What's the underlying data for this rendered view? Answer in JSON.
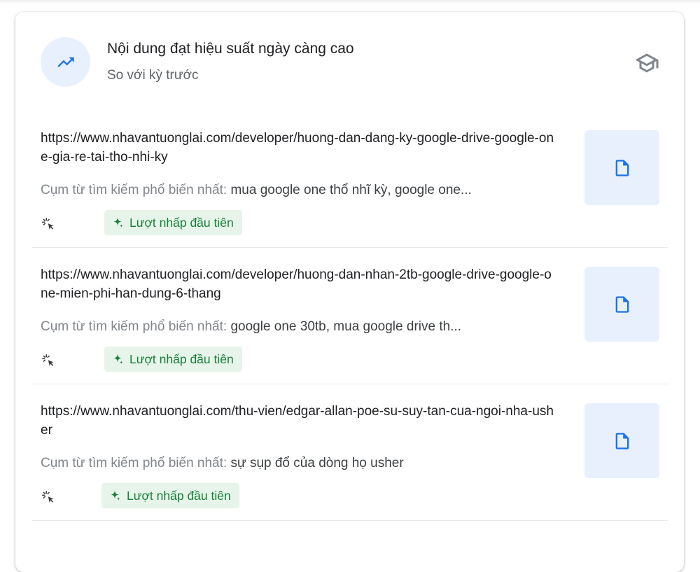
{
  "header": {
    "title": "Nội dung đạt hiệu suất ngày càng cao",
    "subtitle": "So với kỳ trước",
    "trend_icon": "trending-up-icon",
    "learn_icon": "graduation-cap-icon"
  },
  "colors": {
    "accent_blue": "#1a73e8",
    "chip_bg": "#e6f4ea",
    "chip_text": "#188038"
  },
  "rows": [
    {
      "url": "https://www.nhavantuonglai.com/developer/huong-dan-dang-ky-google-drive-google-one-gia-re-tai-tho-nhi-ky",
      "query_label": "Cụm từ tìm kiếm phổ biến nhất: ",
      "query_value": "mua google one thổ nhĩ kỳ, google one...",
      "badge": "Lượt nhấp đầu tiên"
    },
    {
      "url": "https://www.nhavantuonglai.com/developer/huong-dan-nhan-2tb-google-drive-google-one-mien-phi-han-dung-6-thang",
      "query_label": "Cụm từ tìm kiếm phổ biến nhất: ",
      "query_value": "google one 30tb, mua google drive th...",
      "badge": "Lượt nhấp đầu tiên"
    },
    {
      "url": "https://www.nhavantuonglai.com/thu-vien/edgar-allan-poe-su-suy-tan-cua-ngoi-nha-usher",
      "query_label": "Cụm từ tìm kiếm phổ biến nhất: ",
      "query_value": "sự sụp đổ của dòng họ usher",
      "badge": "Lượt nhấp đầu tiên"
    }
  ]
}
